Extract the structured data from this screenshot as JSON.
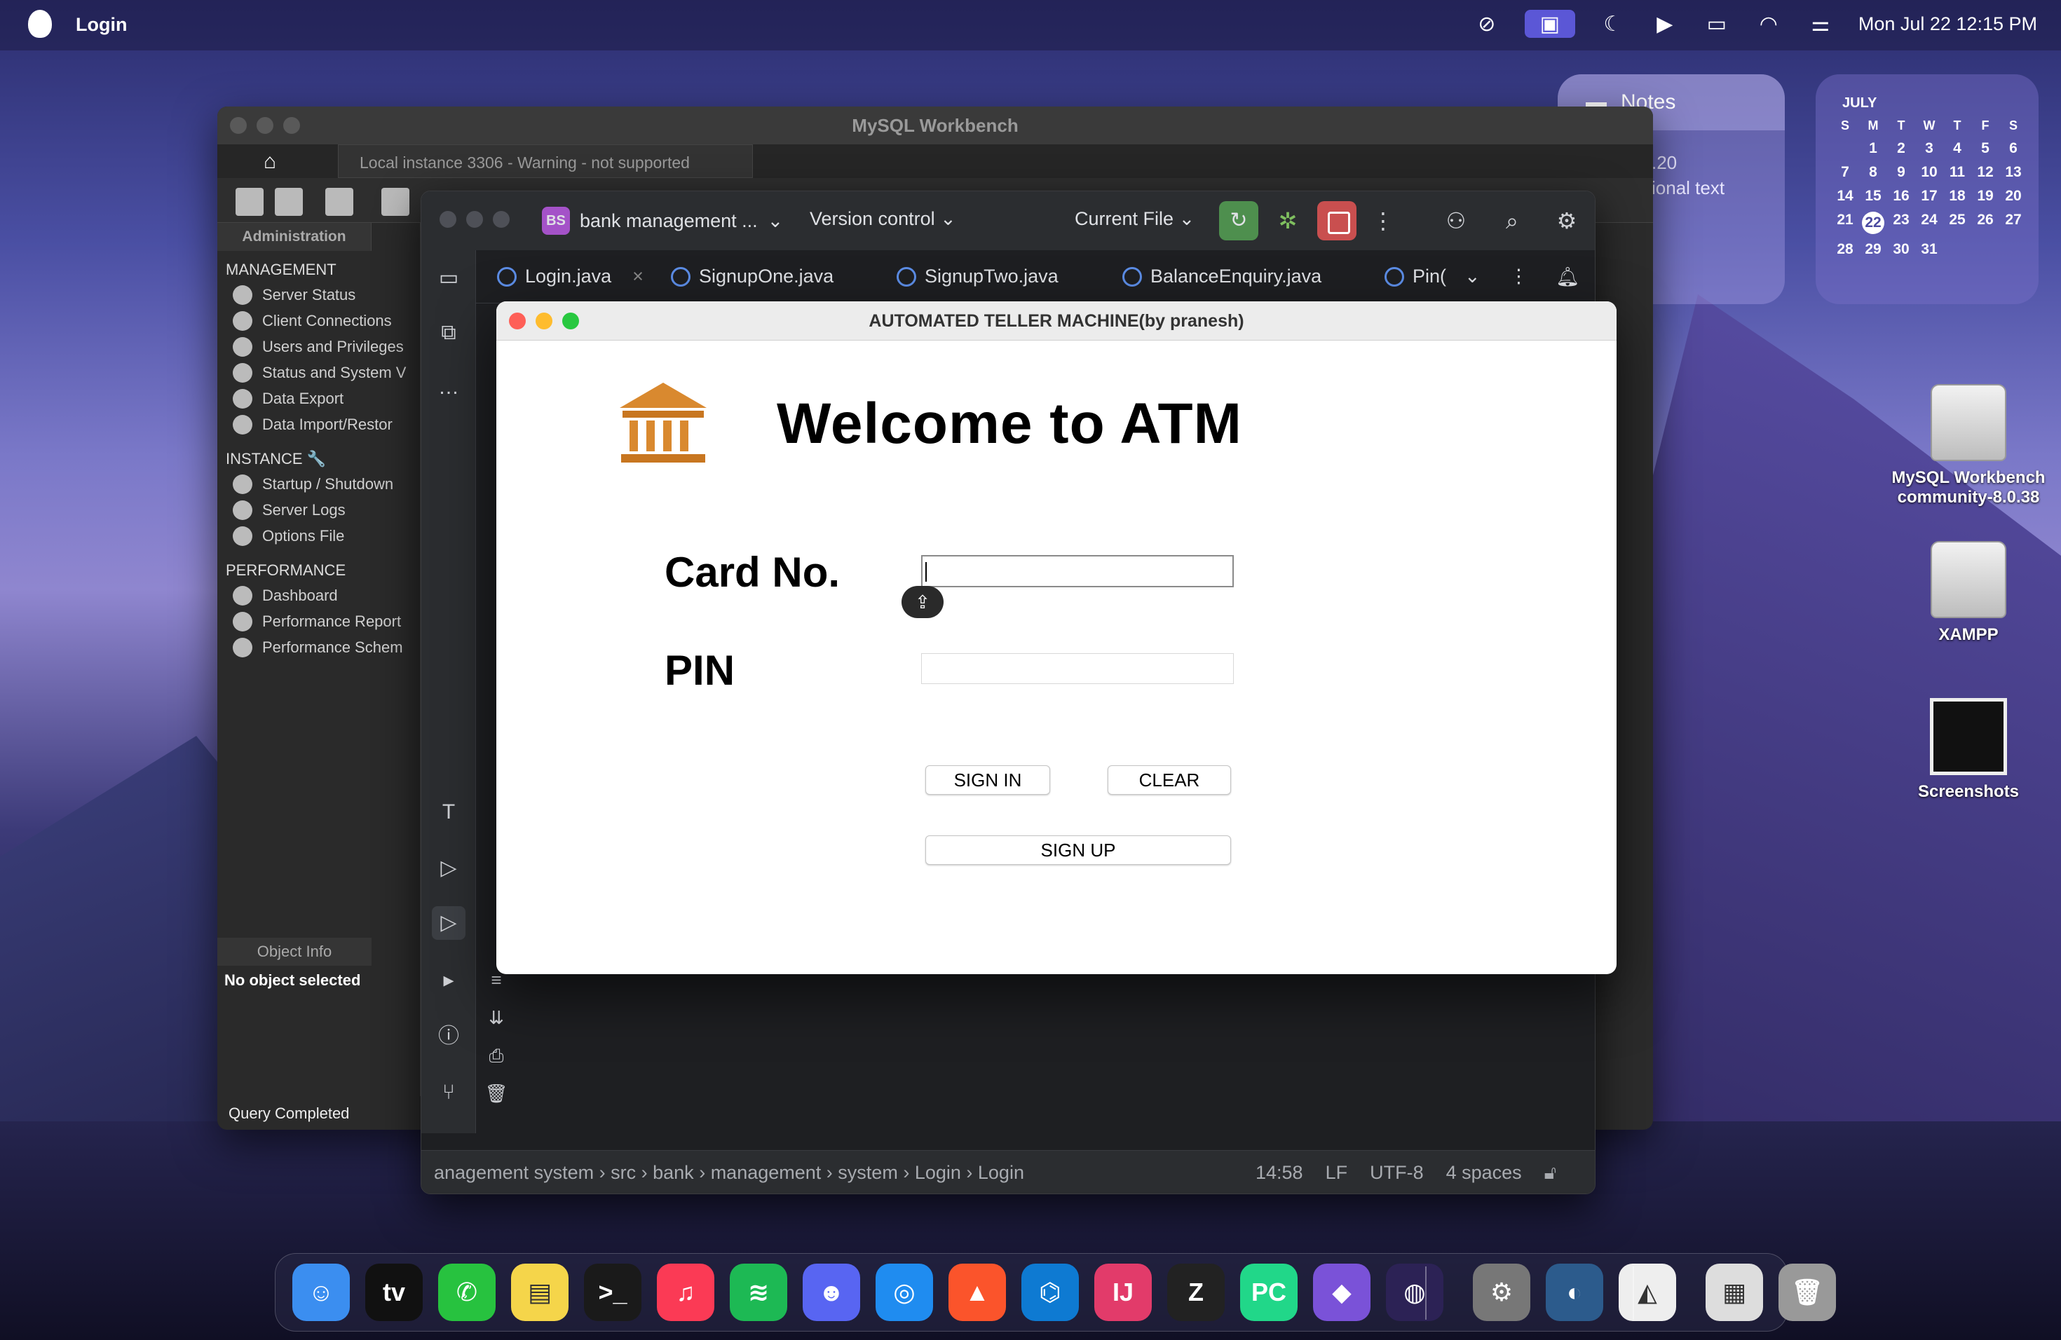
{
  "menubar": {
    "app_name": "Login",
    "datetime": "Mon Jul 22  12:15 PM"
  },
  "notes_widget": {
    "title": "Notes",
    "line1": ".20",
    "line2": "ional text"
  },
  "calendar": {
    "month": "JULY",
    "dow": [
      "S",
      "M",
      "T",
      "W",
      "T",
      "F",
      "S"
    ],
    "weeks": [
      [
        "",
        "1",
        "2",
        "3",
        "4",
        "5",
        "6"
      ],
      [
        "7",
        "8",
        "9",
        "10",
        "11",
        "12",
        "13"
      ],
      [
        "14",
        "15",
        "16",
        "17",
        "18",
        "19",
        "20"
      ],
      [
        "21",
        "22",
        "23",
        "24",
        "25",
        "26",
        "27"
      ],
      [
        "28",
        "29",
        "30",
        "31",
        "",
        "",
        ""
      ]
    ],
    "today": "22"
  },
  "desktop_icons": [
    {
      "label": "MySQL Workbench community-8.0.38"
    },
    {
      "label": "XAMPP"
    },
    {
      "label": "Screenshots"
    }
  ],
  "workbench": {
    "title": "MySQL Workbench",
    "tab": "Local instance 3306 - Warning - not supported",
    "admin_header": "Administration",
    "management_label": "MANAGEMENT",
    "management": [
      "Server Status",
      "Client Connections",
      "Users and Privileges",
      "Status and System V",
      "Data Export",
      "Data Import/Restor"
    ],
    "instance_label": "INSTANCE",
    "instance": [
      "Startup / Shutdown",
      "Server Logs",
      "Options File"
    ],
    "performance_label": "PERFORMANCE",
    "performance": [
      "Dashboard",
      "Performance Report",
      "Performance Schem"
    ],
    "object_info": "Object Info",
    "no_object": "No object selected",
    "status": "Query Completed"
  },
  "ide": {
    "project_badge": "BS",
    "project_name": "bank management ...",
    "version_control": "Version control",
    "run_config": "Current File",
    "tabs": [
      "Login.java",
      "SignupOne.java",
      "SignupTwo.java",
      "BalanceEnquiry.java",
      "Pin("
    ],
    "breadcrumb": [
      "anagement system",
      "src",
      "bank",
      "management",
      "system",
      "Login",
      "Login"
    ],
    "position": "14:58",
    "line_sep": "LF",
    "encoding": "UTF-8",
    "indent": "4 spaces"
  },
  "atm": {
    "window_title": "AUTOMATED TELLER MACHINE(by pranesh)",
    "heading": "Welcome to ATM",
    "card_label": "Card No.",
    "pin_label": "PIN",
    "card_value": "",
    "pin_value": "",
    "sign_in": "SIGN IN",
    "clear": "CLEAR",
    "sign_up": "SIGN UP"
  },
  "dock": [
    "Finder",
    "TV",
    "WhatsApp",
    "Notes",
    "Terminal",
    "Music",
    "Spotify",
    "Discord",
    "Safari",
    "Brave",
    "VS Code",
    "IntelliJ IDEA",
    "Zed",
    "PyCharm",
    "Obsidian",
    "Eclipse",
    "System Settings",
    "MySQL Workbench",
    "NetBeans",
    "Preview",
    "Trash"
  ],
  "colors": {
    "accent": "#5b57d6",
    "atm_logo": "#d9892f",
    "run_green": "#4e8f4e",
    "stop_red": "#c94f4f"
  }
}
